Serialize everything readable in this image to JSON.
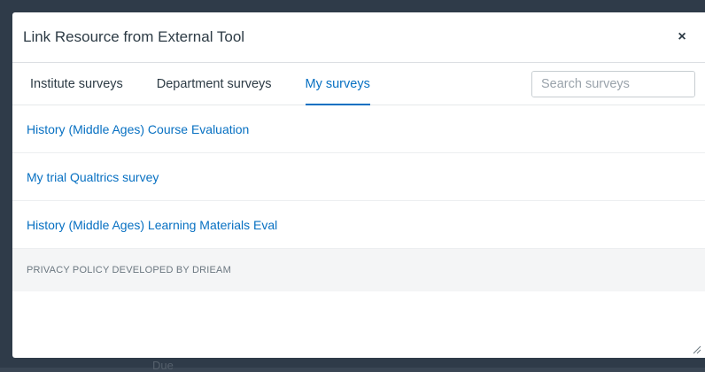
{
  "modal": {
    "title": "Link Resource from External Tool",
    "close_label": "×"
  },
  "tabs": [
    {
      "label": "Institute surveys",
      "active": false
    },
    {
      "label": "Department surveys",
      "active": false
    },
    {
      "label": "My surveys",
      "active": true
    }
  ],
  "search": {
    "placeholder": "Search surveys",
    "value": ""
  },
  "surveys": [
    {
      "title": "History (Middle Ages) Course Evaluation"
    },
    {
      "title": "My trial Qualtrics survey"
    },
    {
      "title": "History (Middle Ages) Learning Materials Eval"
    }
  ],
  "footer": {
    "text": "PRIVACY POLICY DEVELOPED BY DRIEAM"
  },
  "colors": {
    "accent": "#0770c2",
    "text": "#2d3b45",
    "backdrop": "#2f3b49"
  },
  "background": {
    "partial_text": "Due"
  }
}
